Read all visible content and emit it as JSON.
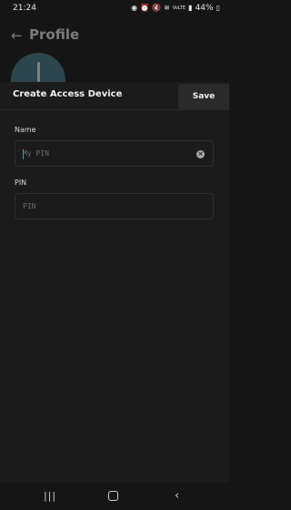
{
  "status_bar": {
    "time": "21:24",
    "battery": "44%",
    "network": "VoLTE",
    "icons": [
      "whatsapp-icon",
      "alarm-icon",
      "mute-icon",
      "wifi-icon",
      "signal-icon",
      "battery-icon"
    ]
  },
  "background_page": {
    "title": "Profile",
    "back_icon": "arrow-left-icon"
  },
  "sheet": {
    "title": "Create Access Device",
    "save_label": "Save"
  },
  "form": {
    "name": {
      "label": "Name",
      "value": "",
      "placeholder": "My PIN",
      "clear_icon": "close-circle-icon"
    },
    "pin": {
      "label": "PIN",
      "value": "",
      "placeholder": "PIN"
    }
  },
  "nav_bar": {
    "icons": [
      "recents-icon",
      "home-icon",
      "back-icon"
    ]
  },
  "colors": {
    "background": "#151515",
    "sheet": "#1b1b1b",
    "accent_cursor": "#3aa6a0",
    "avatar": "#3d6e7a"
  }
}
